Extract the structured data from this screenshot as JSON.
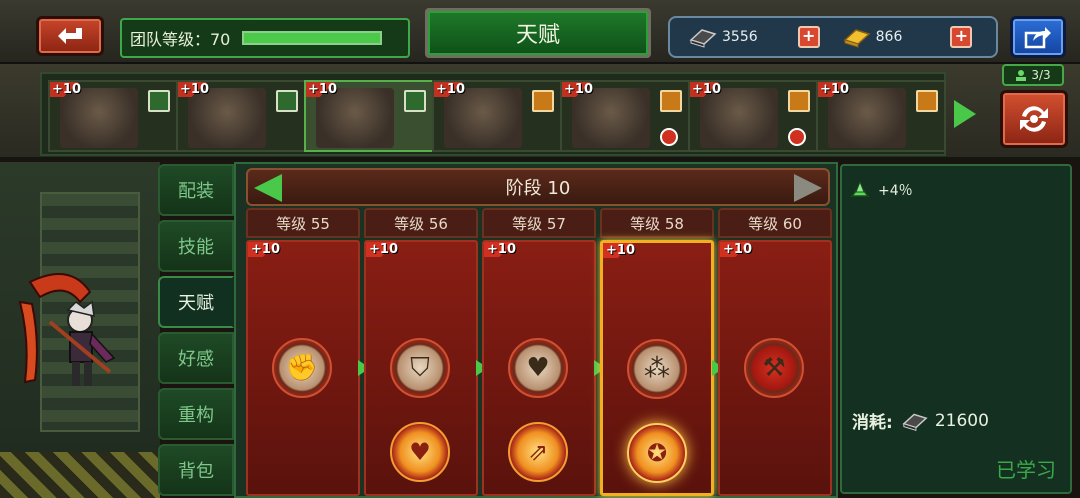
{
  "topbar": {
    "team_level_label": "团队等级：70",
    "team_level_progress": 1.0,
    "title": "天赋",
    "currency_1_value": "3556",
    "currency_2_value": "866"
  },
  "heroes": [
    {
      "level": "+10",
      "role": "support"
    },
    {
      "level": "+10",
      "role": "support"
    },
    {
      "level": "+10",
      "role": "support",
      "selected": true
    },
    {
      "level": "+10",
      "role": "attack"
    },
    {
      "level": "+10",
      "role": "attack",
      "warning": true
    },
    {
      "level": "+10",
      "role": "attack",
      "warning": true
    },
    {
      "level": "+10",
      "role": "attack"
    }
  ],
  "team_count": "3/3",
  "side_tabs": [
    "配装",
    "技能",
    "天赋",
    "好感",
    "重构",
    "背包"
  ],
  "active_tab": "天赋",
  "stage": {
    "label": "阶段 10"
  },
  "level_labels": [
    "等级 55",
    "等级 56",
    "等级 57",
    "等级 58",
    "等级 60"
  ],
  "talent_cols": [
    {
      "plus": "+10",
      "top_icon": "fist-icon",
      "bottom_icon": null
    },
    {
      "plus": "+10",
      "top_icon": "shield-icon",
      "bottom_icon": "heart-burst-icon"
    },
    {
      "plus": "+10",
      "top_icon": "heart-icon",
      "bottom_icon": "gold-arrow-icon"
    },
    {
      "plus": "+10",
      "top_icon": "splash-icon",
      "bottom_icon": "strength-icon"
    },
    {
      "plus": "+10",
      "top_icon": "scythe-icon",
      "bottom_icon": null
    }
  ],
  "right": {
    "bonus": "+4％",
    "cost_label": "消耗:",
    "cost_value": "21600",
    "status": "已学习"
  },
  "colors": {
    "accent_green": "#4ac84a",
    "panel_red": "#8a1e14",
    "selected_gold": "#f0b020"
  }
}
